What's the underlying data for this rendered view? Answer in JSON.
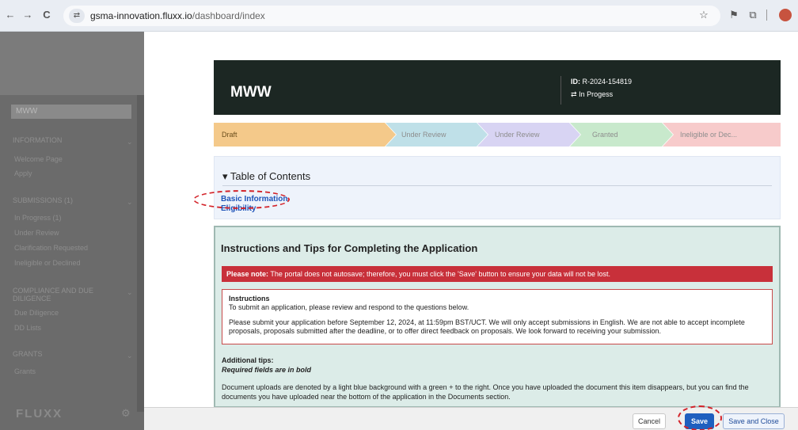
{
  "browser": {
    "back": "←",
    "forward": "→",
    "reload": "C",
    "site_icon": "⇄",
    "url_host": "gsma-innovation.fluxx.io",
    "url_path": "/dashboard/index",
    "star": "☆",
    "ext1": "⚑",
    "ext2": "⧉"
  },
  "sidebar": {
    "selected": "MWW",
    "sections": [
      {
        "label": "INFORMATION",
        "links": [
          "Welcome Page",
          "Apply"
        ]
      },
      {
        "label": "SUBMISSIONS (1)",
        "links": [
          "In Progress (1)",
          "Under Review",
          "Clarification Requested",
          "Ineligible or Declined"
        ]
      },
      {
        "label": "COMPLIANCE AND DUE DILIGENCE",
        "links": [
          "Due Diligence",
          "DD Lists"
        ]
      },
      {
        "label": "GRANTS",
        "links": [
          "Grants"
        ]
      }
    ],
    "logo": "FLUXX",
    "gear": "⚙"
  },
  "header": {
    "title": "MWW",
    "id_label": "ID:",
    "id_value": "R-2024-154819",
    "status_icon": "⇄",
    "status": "In Progess"
  },
  "steps": [
    "Draft",
    "Under Review",
    "Under Review",
    "Granted",
    "Ineligible or Dec..."
  ],
  "toc": {
    "title": "▾ Table of Contents",
    "links": [
      "Basic Information",
      "Eligibility"
    ]
  },
  "instructions": {
    "title": "Instructions and Tips for Completing the Application",
    "alert_bold": "Please note:",
    "alert_text": " The portal does not autosave; therefore, you must click the 'Save' button to ensure your data will not be lost.",
    "box_title": "Instructions",
    "box_line1": "To submit an application, please review and respond to the questions below.",
    "box_line2": "Please submit your application before September 12, 2024, at 11:59pm BST/UCT. We will only accept submissions in English. We are not able to accept incomplete proposals, proposals submitted after the deadline, or to offer direct feedback on proposals. We look forward to receiving your submission.",
    "additional_tips": "Additional tips:",
    "required_bold": "Required fields are in bold",
    "doc_text": "Document uploads are denoted by a light blue background with a green + to the right. Once you have uploaded the document this item disappears, but you can find the documents you have uploaded near the bottom of the application in the Documents section."
  },
  "footer": {
    "cancel": "Cancel",
    "save": "Save",
    "save_close": "Save and Close"
  }
}
